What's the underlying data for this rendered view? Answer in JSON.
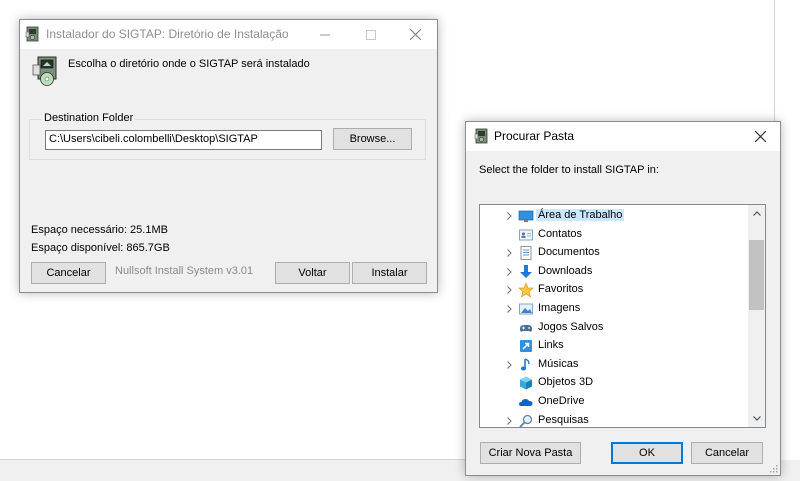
{
  "installer": {
    "title": "Instalador do SIGTAP: Diretório de Instalação",
    "header_text": "Escolha o diretório onde o SIGTAP será instalado",
    "destination_label": "Destination Folder",
    "destination_path": "C:\\Users\\cibeli.colombelli\\Desktop\\SIGTAP",
    "browse_label": "Browse...",
    "space_required": "Espaço necessário: 25.1MB",
    "space_available": "Espaço disponível: 865.7GB",
    "cancel_label": "Cancelar",
    "nsis_label": "Nullsoft Install System v3.01",
    "back_label": "Voltar",
    "install_label": "Instalar"
  },
  "browse_dialog": {
    "title": "Procurar Pasta",
    "prompt": "Select the folder to install SIGTAP in:",
    "folders": [
      {
        "label": "Área de Trabalho",
        "icon": "desktop-folder-icon",
        "expandable": true,
        "selected": true
      },
      {
        "label": "Contatos",
        "icon": "contacts-folder-icon",
        "expandable": false,
        "selected": false
      },
      {
        "label": "Documentos",
        "icon": "documents-folder-icon",
        "expandable": true,
        "selected": false
      },
      {
        "label": "Downloads",
        "icon": "downloads-folder-icon",
        "expandable": true,
        "selected": false
      },
      {
        "label": "Favoritos",
        "icon": "favorites-folder-icon",
        "expandable": true,
        "selected": false
      },
      {
        "label": "Imagens",
        "icon": "pictures-folder-icon",
        "expandable": true,
        "selected": false
      },
      {
        "label": "Jogos Salvos",
        "icon": "saved-games-folder-icon",
        "expandable": false,
        "selected": false
      },
      {
        "label": "Links",
        "icon": "links-folder-icon",
        "expandable": false,
        "selected": false
      },
      {
        "label": "Músicas",
        "icon": "music-folder-icon",
        "expandable": true,
        "selected": false
      },
      {
        "label": "Objetos 3D",
        "icon": "3d-objects-folder-icon",
        "expandable": false,
        "selected": false
      },
      {
        "label": "OneDrive",
        "icon": "onedrive-icon",
        "expandable": false,
        "selected": false
      },
      {
        "label": "Pesquisas",
        "icon": "searches-folder-icon",
        "expandable": true,
        "selected": false
      }
    ],
    "new_folder_label": "Criar Nova Pasta",
    "ok_label": "OK",
    "cancel_label": "Cancelar"
  },
  "colors": {
    "selection": "#cce8ff",
    "accent": "#0078d7",
    "dialog_bg": "#f0f0f0"
  }
}
